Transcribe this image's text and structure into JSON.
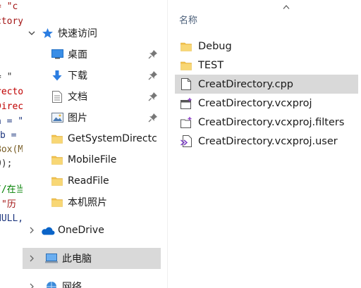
{
  "code_fragments": [
    "= \"c",
    "ctory",
    "",
    "",
    "",
    "= \"",
    "rectory",
    "Direc",
    "a = \"",
    "b =",
    "Box(M",
    "0);",
    "",
    "//在当",
    "\"历",
    "NULL,"
  ],
  "nav": {
    "quick_access": {
      "label": "快速访问",
      "items": [
        {
          "label": "桌面",
          "icon": "desktop-icon",
          "pinned": true
        },
        {
          "label": "下载",
          "icon": "download-icon",
          "pinned": true
        },
        {
          "label": "文档",
          "icon": "document-icon",
          "pinned": true
        },
        {
          "label": "图片",
          "icon": "pictures-icon",
          "pinned": true
        },
        {
          "label": "GetSystemDirectc",
          "icon": "folder-icon",
          "pinned": false
        },
        {
          "label": "MobileFile",
          "icon": "folder-icon",
          "pinned": false
        },
        {
          "label": "ReadFile",
          "icon": "folder-icon",
          "pinned": false
        },
        {
          "label": "本机照片",
          "icon": "folder-icon",
          "pinned": false
        }
      ]
    },
    "onedrive": {
      "label": "OneDrive"
    },
    "this_pc": {
      "label": "此电脑"
    },
    "network": {
      "label": "网络"
    }
  },
  "content": {
    "column_header": "名称",
    "files": [
      {
        "name": "Debug",
        "type": "folder"
      },
      {
        "name": "TEST",
        "type": "folder"
      },
      {
        "name": "CreatDirectory.cpp",
        "type": "cpp",
        "selected": true
      },
      {
        "name": "CreatDirectory.vcxproj",
        "type": "vcxproj"
      },
      {
        "name": "CreatDirectory.vcxproj.filters",
        "type": "filters"
      },
      {
        "name": "CreatDirectory.vcxproj.user",
        "type": "user"
      }
    ]
  },
  "colors": {
    "folder": "#f2c14e",
    "selection": "#d9d9d9",
    "accent_blue": "#1f6fc5",
    "onedrive": "#0a64c8",
    "code_string": "#a31515",
    "code_red": "#c00000",
    "code_func": "#795e26",
    "code_var": "#1f377f",
    "code_comment": "#008000"
  }
}
